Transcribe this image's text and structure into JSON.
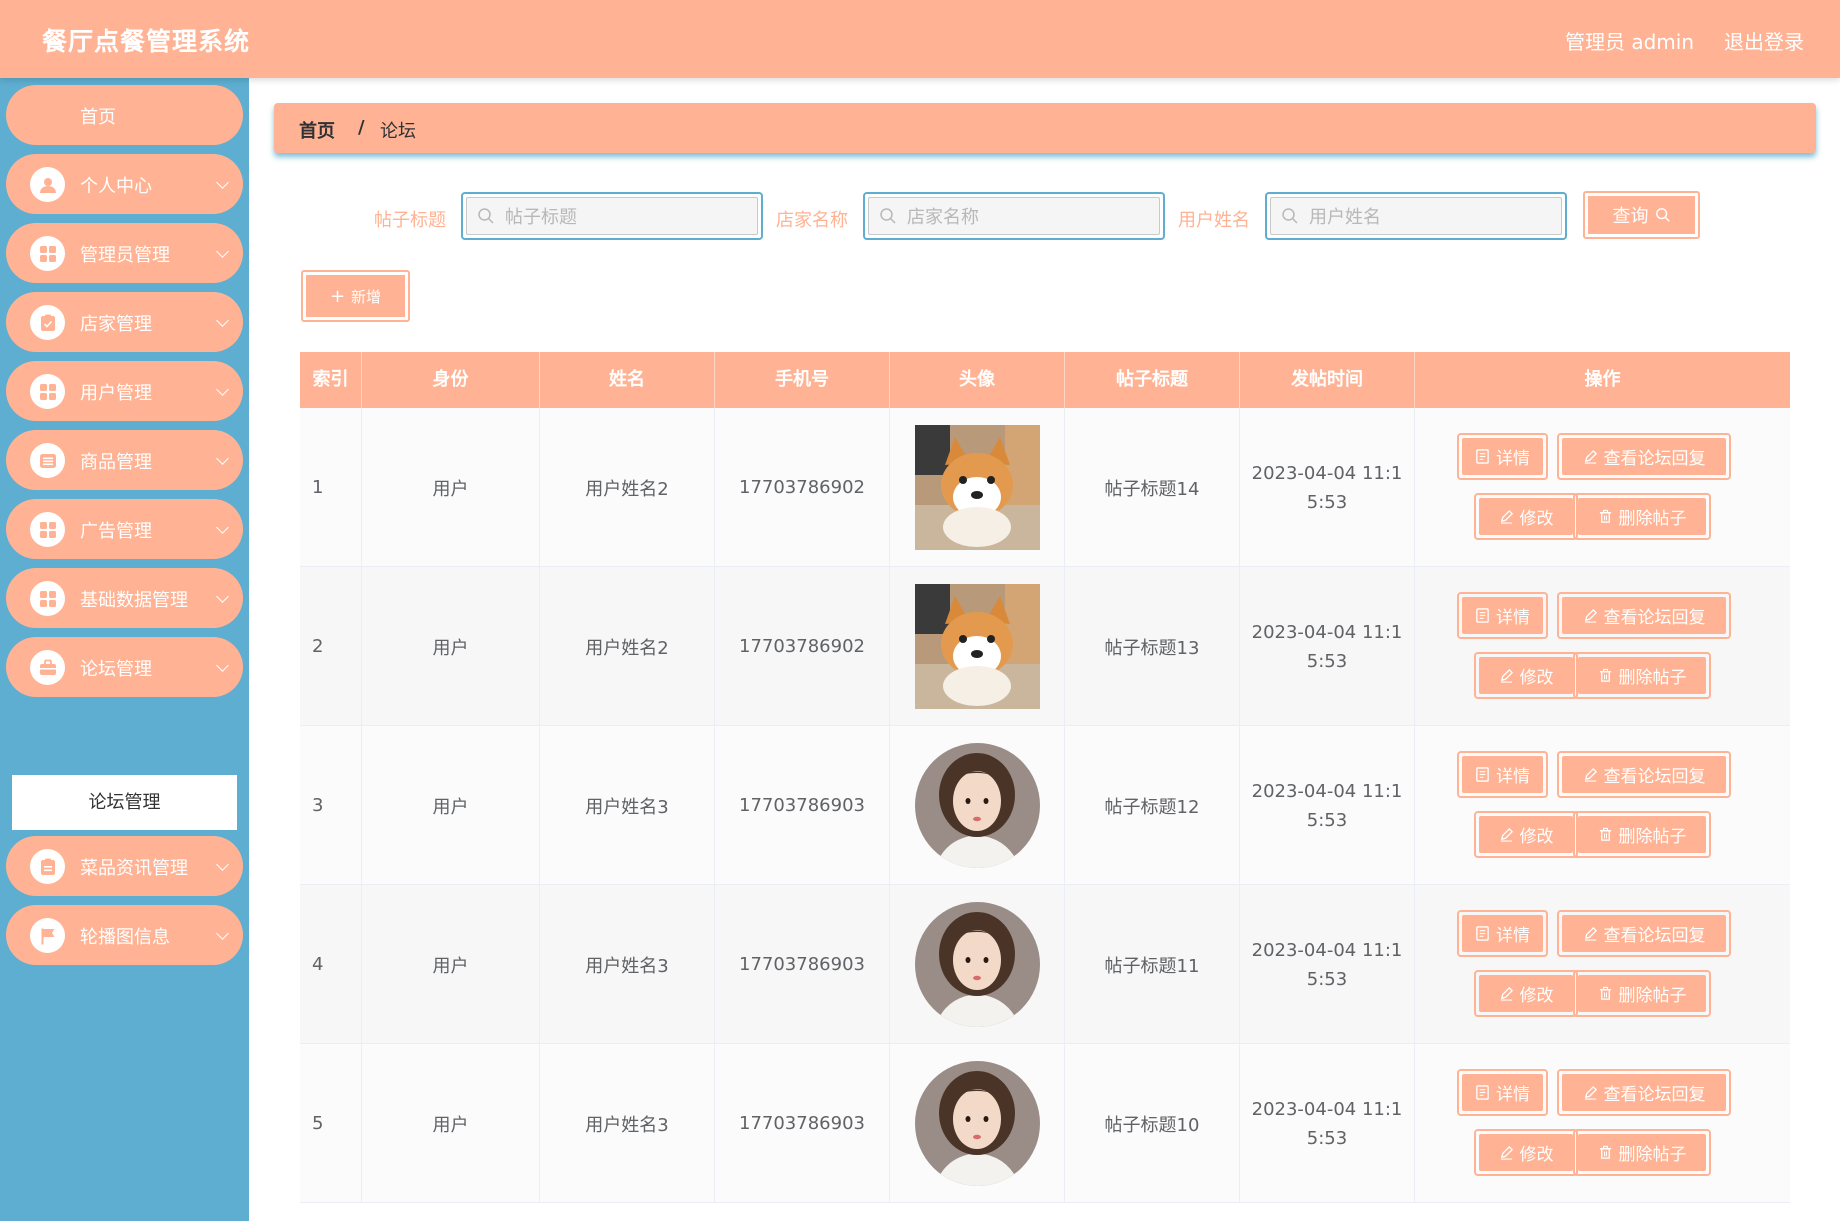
{
  "header": {
    "app_title": "餐厅点餐管理系统",
    "user_info": "管理员 admin",
    "logout_label": "退出登录"
  },
  "sidebar": {
    "home_label": "首页",
    "items": [
      {
        "label": "个人中心",
        "icon": "user-icon"
      },
      {
        "label": "管理员管理",
        "icon": "grid-icon"
      },
      {
        "label": "店家管理",
        "icon": "clipboard-icon"
      },
      {
        "label": "用户管理",
        "icon": "grid-icon"
      },
      {
        "label": "商品管理",
        "icon": "list-icon"
      },
      {
        "label": "广告管理",
        "icon": "grid-icon"
      },
      {
        "label": "基础数据管理",
        "icon": "grid-icon"
      },
      {
        "label": "论坛管理",
        "icon": "briefcase-icon"
      },
      {
        "label": "菜品资讯管理",
        "icon": "clipboard-icon"
      },
      {
        "label": "轮播图信息",
        "icon": "flag-icon"
      }
    ],
    "active_submenu": "论坛管理"
  },
  "breadcrumb": {
    "home": "首页",
    "separator": "/",
    "current": "论坛"
  },
  "search": {
    "title_label": "帖子标题",
    "title_placeholder": "帖子标题",
    "shop_label": "店家名称",
    "shop_placeholder": "店家名称",
    "user_label": "用户姓名",
    "user_placeholder": "用户姓名",
    "query_label": "查询"
  },
  "toolbar": {
    "add_label": "新增"
  },
  "table": {
    "columns": [
      "索引",
      "身份",
      "姓名",
      "手机号",
      "头像",
      "帖子标题",
      "发帖时间",
      "操作"
    ],
    "rows": [
      {
        "index": "1",
        "role": "用户",
        "name": "用户姓名2",
        "phone": "17703786902",
        "avatar": "dog",
        "title": "帖子标题14",
        "time1": "2023-04-04 11:1",
        "time2": "5:53"
      },
      {
        "index": "2",
        "role": "用户",
        "name": "用户姓名2",
        "phone": "17703786902",
        "avatar": "dog",
        "title": "帖子标题13",
        "time1": "2023-04-04 11:1",
        "time2": "5:53"
      },
      {
        "index": "3",
        "role": "用户",
        "name": "用户姓名3",
        "phone": "17703786903",
        "avatar": "girl",
        "title": "帖子标题12",
        "time1": "2023-04-04 11:1",
        "time2": "5:53"
      },
      {
        "index": "4",
        "role": "用户",
        "name": "用户姓名3",
        "phone": "17703786903",
        "avatar": "girl",
        "title": "帖子标题11",
        "time1": "2023-04-04 11:1",
        "time2": "5:53"
      },
      {
        "index": "5",
        "role": "用户",
        "name": "用户姓名3",
        "phone": "17703786903",
        "avatar": "girl",
        "title": "帖子标题10",
        "time1": "2023-04-04 11:1",
        "time2": "5:53"
      }
    ],
    "actions": {
      "detail": "详情",
      "view_replies": "查看论坛回复",
      "edit": "修改",
      "delete": "删除帖子"
    }
  },
  "colors": {
    "accent": "#ffb394",
    "sidebar_bg": "#5daed0"
  }
}
